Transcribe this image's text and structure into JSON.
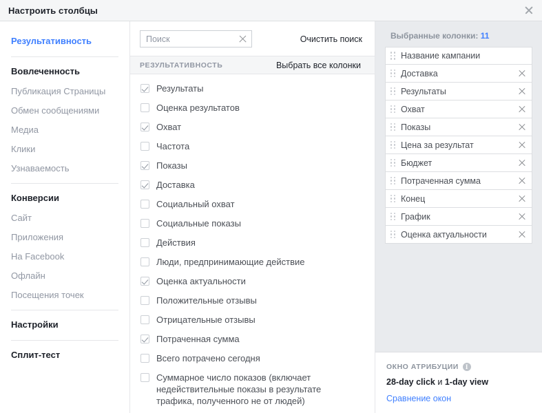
{
  "dialog": {
    "title": "Настроить столбцы",
    "close_icon": "close-icon"
  },
  "sidebar": {
    "groups": [
      {
        "label": "Результативность",
        "active": true,
        "items": []
      },
      {
        "label": "Вовлеченность",
        "active": false,
        "items": [
          "Публикация Страницы",
          "Обмен сообщениями",
          "Медиа",
          "Клики",
          "Узнаваемость"
        ]
      },
      {
        "label": "Конверсии",
        "active": false,
        "items": [
          "Сайт",
          "Приложения",
          "На Facebook",
          "Офлайн",
          "Посещения точек"
        ]
      },
      {
        "label": "Настройки",
        "active": false,
        "items": []
      },
      {
        "label": "Сплит-тест",
        "active": false,
        "items": []
      }
    ]
  },
  "search": {
    "value": "",
    "placeholder": "Поиск",
    "clear_icon": "clear-icon",
    "clear_link": "Очистить поиск"
  },
  "options_panel": {
    "group_title": "РЕЗУЛЬТАТИВНОСТЬ",
    "select_all": "Выбрать все колонки",
    "options": [
      {
        "label": "Результаты",
        "checked": true
      },
      {
        "label": "Оценка результатов",
        "checked": false
      },
      {
        "label": "Охват",
        "checked": true
      },
      {
        "label": "Частота",
        "checked": false
      },
      {
        "label": "Показы",
        "checked": true
      },
      {
        "label": "Доставка",
        "checked": true
      },
      {
        "label": "Социальный охват",
        "checked": false
      },
      {
        "label": "Социальные показы",
        "checked": false
      },
      {
        "label": "Действия",
        "checked": false
      },
      {
        "label": "Люди, предпринимающие действие",
        "checked": false
      },
      {
        "label": "Оценка актуальности",
        "checked": true
      },
      {
        "label": "Положительные отзывы",
        "checked": false
      },
      {
        "label": "Отрицательные отзывы",
        "checked": false
      },
      {
        "label": "Потраченная сумма",
        "checked": true
      },
      {
        "label": "Всего потрачено сегодня",
        "checked": false
      },
      {
        "label": "Суммарное число показов (включает недействительные показы в результате трафика, полученного не от людей)",
        "checked": false
      }
    ]
  },
  "selected_panel": {
    "count_label": "Выбранные колонки:",
    "count": "11",
    "columns": [
      {
        "label": "Название кампании",
        "removable": false
      },
      {
        "label": "Доставка",
        "removable": true
      },
      {
        "label": "Результаты",
        "removable": true
      },
      {
        "label": "Охват",
        "removable": true
      },
      {
        "label": "Показы",
        "removable": true
      },
      {
        "label": "Цена за результат",
        "removable": true
      },
      {
        "label": "Бюджет",
        "removable": true
      },
      {
        "label": "Потраченная сумма",
        "removable": true
      },
      {
        "label": "Конец",
        "removable": true
      },
      {
        "label": "График",
        "removable": true
      },
      {
        "label": "Оценка актуальности",
        "removable": true
      }
    ]
  },
  "attribution": {
    "title": "ОКНО АТРИБУЦИИ",
    "info_icon": "info-icon",
    "value_click": "28-day click",
    "value_conj": "и",
    "value_view": "1-day view",
    "link": "Сравнение окон"
  },
  "colors": {
    "accent": "#4080ff",
    "panel_bg": "#e9ebee",
    "header_bg": "#f5f6f7",
    "border": "#e5e6e9",
    "text": "#1d2129",
    "muted": "#9197a3"
  }
}
